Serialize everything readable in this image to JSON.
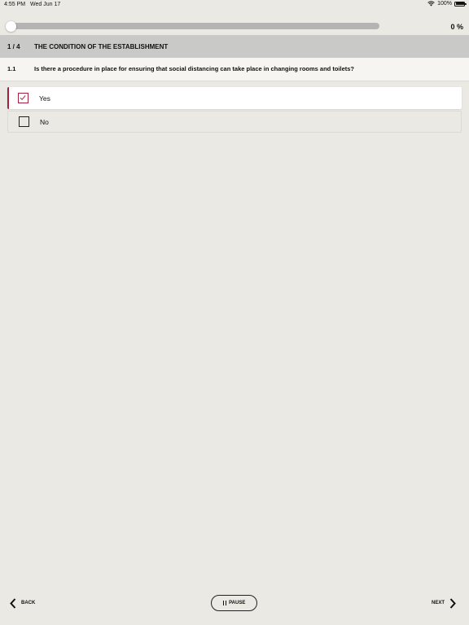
{
  "status_bar": {
    "time": "4:55 PM",
    "date": "Wed Jun 17",
    "battery": "100%",
    "icons": [
      "wifi-icon",
      "battery-icon"
    ]
  },
  "progress": {
    "value": 0,
    "label": "0 %"
  },
  "section": {
    "index": "1 / 4",
    "title": "THE CONDITION OF THE ESTABLISHMENT"
  },
  "question": {
    "number": "1.1",
    "text": "Is there a procedure in place for ensuring that social distancing can take place in changing rooms and toilets?"
  },
  "answers": [
    {
      "label": "Yes",
      "checked": true
    },
    {
      "label": "No",
      "checked": false
    }
  ],
  "navigation": {
    "back_label": "BACK",
    "pause_label": "PAUSE",
    "next_label": "NEXT"
  },
  "colors": {
    "background": "#ebe9e4",
    "header": "#c9c9c7",
    "accent": "#a3233f",
    "progress_track": "#b4b4b4"
  }
}
